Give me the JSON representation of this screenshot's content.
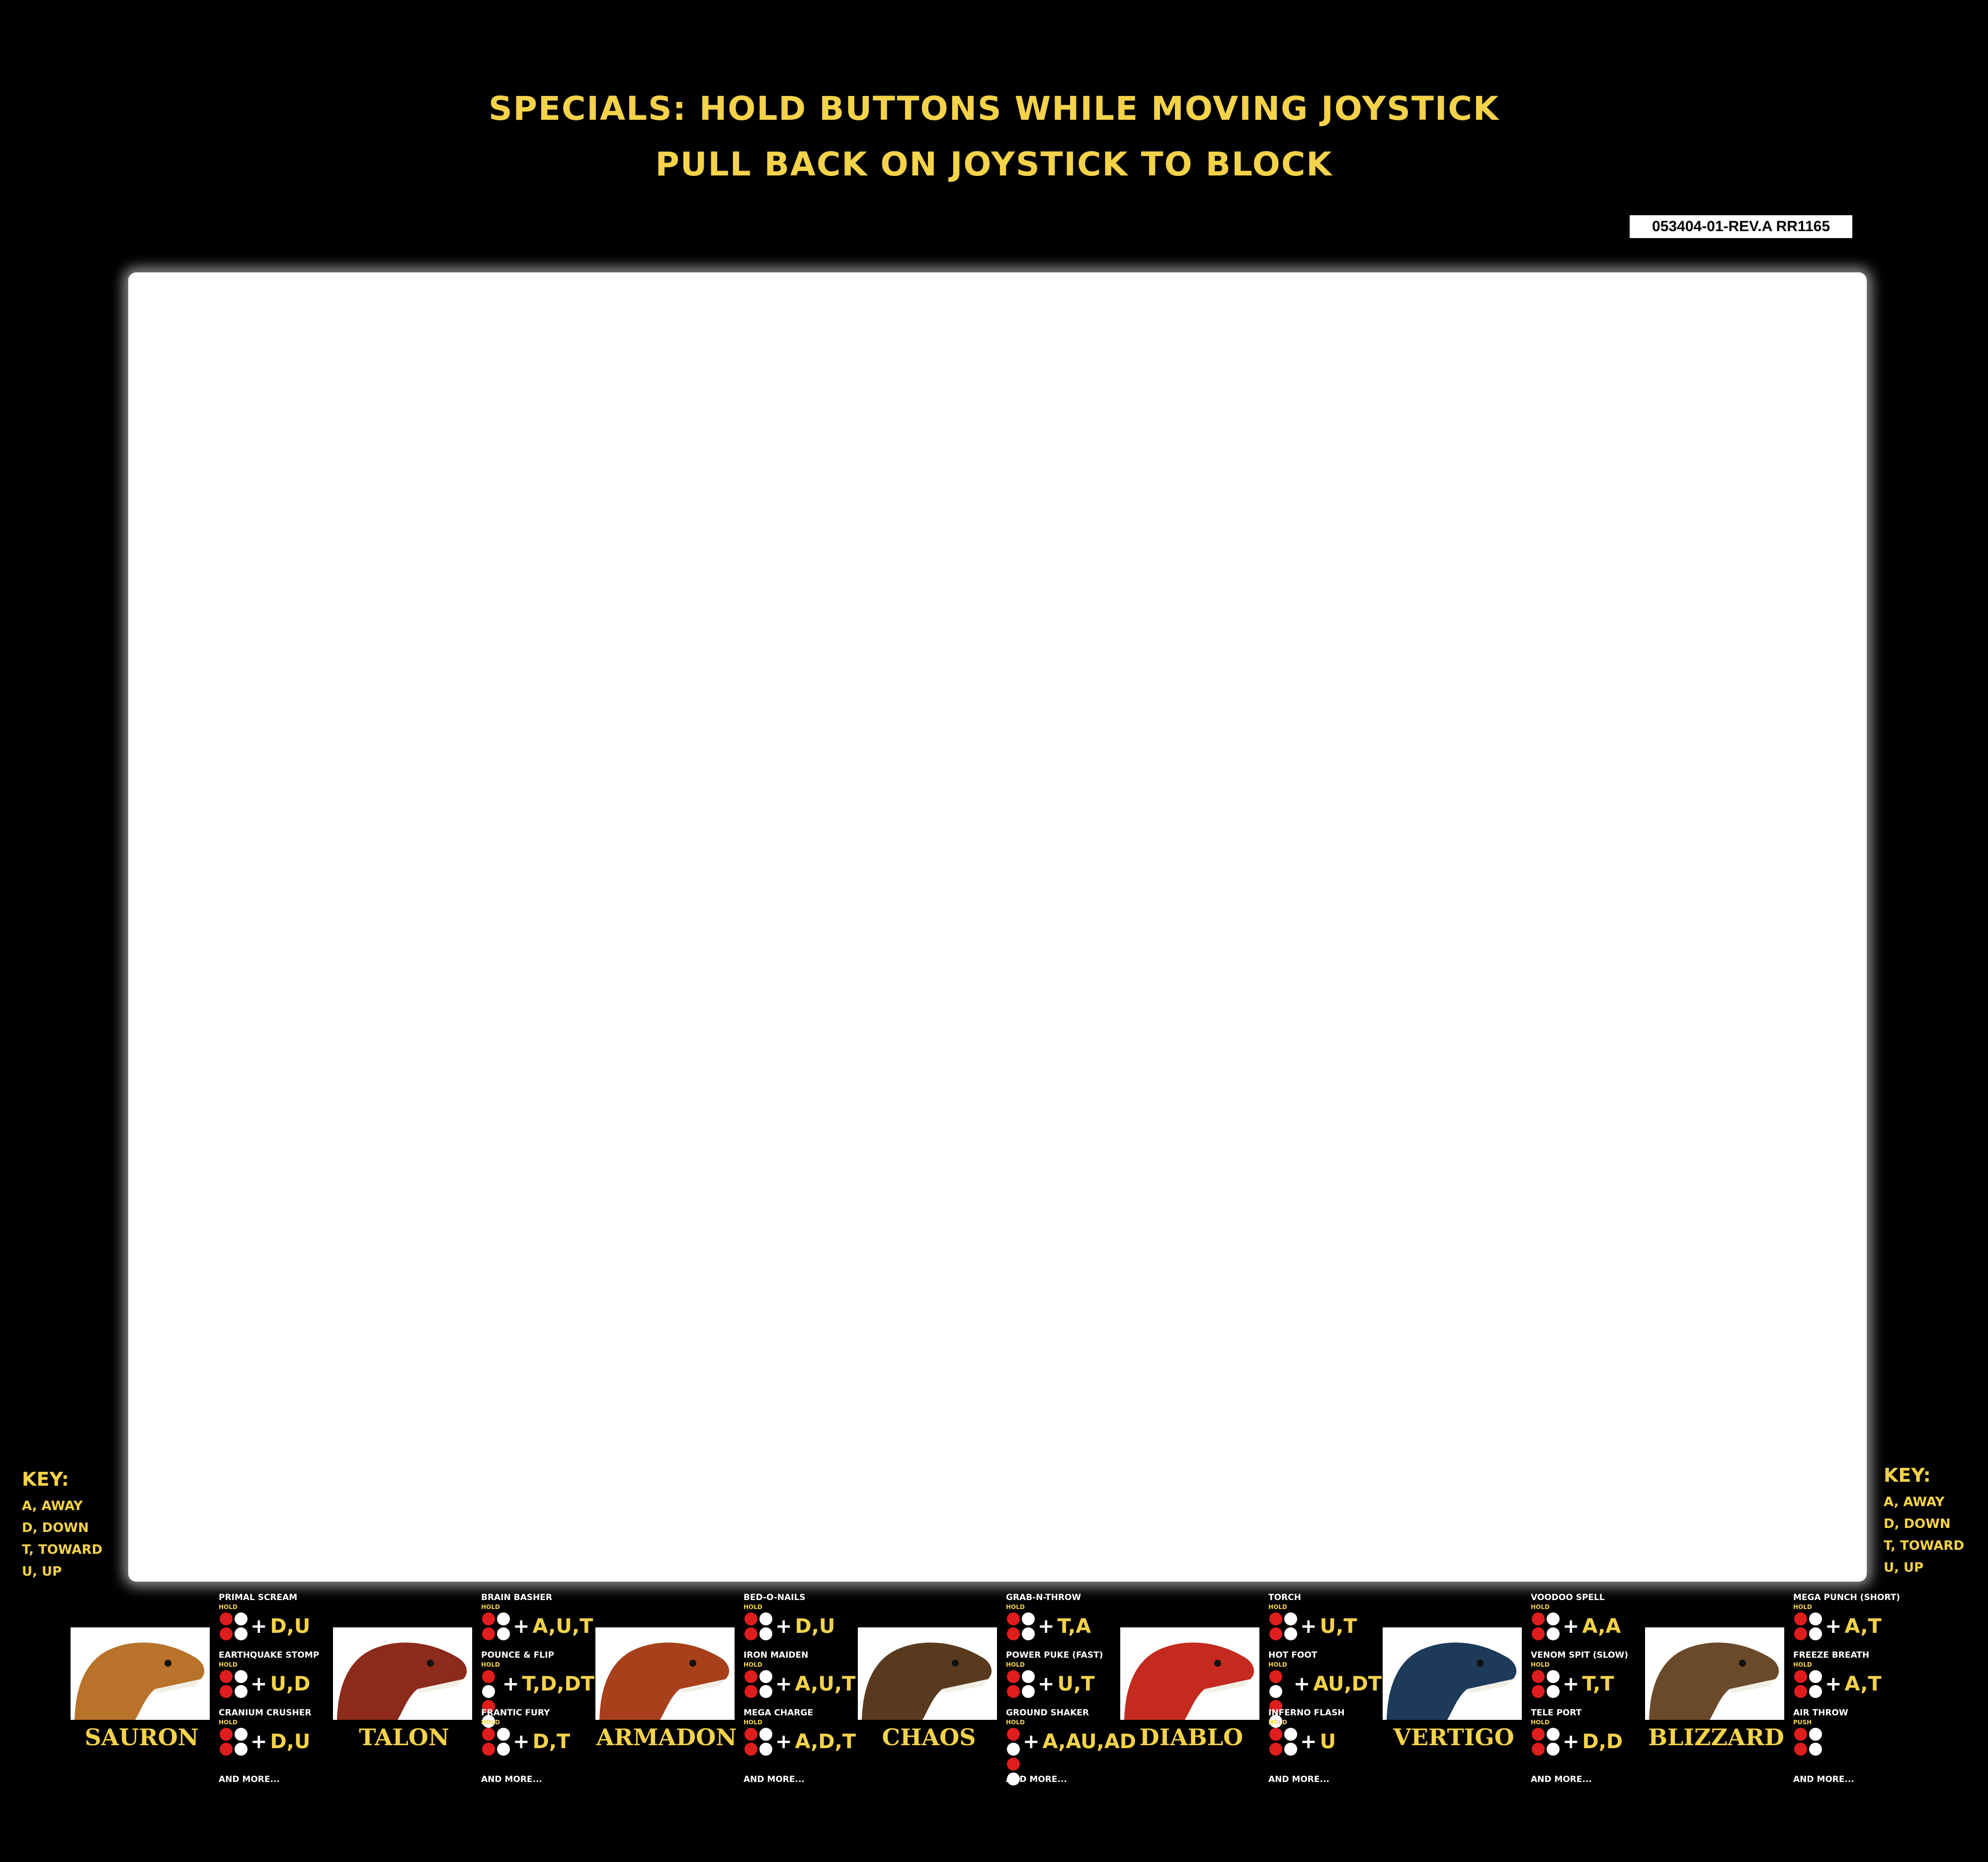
{
  "header": {
    "line1": "SPECIALS: HOLD BUTTONS WHILE MOVING JOYSTICK",
    "line2": "PULL BACK ON JOYSTICK TO BLOCK",
    "part_number": "053404-01-REV.A RR1165"
  },
  "key": {
    "title": "KEY:",
    "lines": [
      "A, AWAY",
      "D, DOWN",
      "T, TOWARD",
      "U, UP"
    ]
  },
  "colors": {
    "accent": "#f4d24a",
    "button_red": "#e01d1d",
    "background": "#000000"
  },
  "fighters": [
    {
      "name": "SAURON",
      "portrait_color": "#b8722a",
      "moves": [
        {
          "name": "PRIMAL SCREAM",
          "label": "HOLD",
          "combo": "D,U"
        },
        {
          "name": "EARTHQUAKE STOMP",
          "label": "HOLD",
          "combo": "U,D"
        },
        {
          "name": "CRANIUM CRUSHER",
          "label": "HOLD",
          "combo": "D,U"
        }
      ],
      "more": "AND MORE..."
    },
    {
      "name": "TALON",
      "portrait_color": "#8c2a1c",
      "moves": [
        {
          "name": "BRAIN BASHER",
          "label": "HOLD",
          "combo": "A,U,T"
        },
        {
          "name": "POUNCE & FLIP",
          "label": "HOLD",
          "combo": "T,D,DT"
        },
        {
          "name": "FRANTIC FURY",
          "label": "HOLD",
          "combo": "D,T"
        }
      ],
      "more": "AND MORE..."
    },
    {
      "name": "ARMADON",
      "portrait_color": "#a8401c",
      "moves": [
        {
          "name": "BED-O-NAILS",
          "label": "HOLD",
          "combo": "D,U"
        },
        {
          "name": "IRON MAIDEN",
          "label": "HOLD",
          "combo": "A,U,T"
        },
        {
          "name": "MEGA CHARGE",
          "label": "HOLD",
          "combo": "A,D,T"
        }
      ],
      "more": "AND MORE..."
    },
    {
      "name": "CHAOS",
      "portrait_color": "#5a3a1e",
      "moves": [
        {
          "name": "GRAB-N-THROW",
          "label": "HOLD",
          "combo": "T,A"
        },
        {
          "name": "POWER PUKE (FAST)",
          "label": "HOLD",
          "combo": "U,T"
        },
        {
          "name": "GROUND SHAKER",
          "label": "HOLD",
          "combo": "A,AU,AD"
        }
      ],
      "more": "AND MORE..."
    },
    {
      "name": "DIABLO",
      "portrait_color": "#c42a1e",
      "moves": [
        {
          "name": "TORCH",
          "label": "HOLD",
          "combo": "U,T"
        },
        {
          "name": "HOT FOOT",
          "label": "HOLD",
          "combo": "AU,DT"
        },
        {
          "name": "INFERNO FLASH",
          "label": "HOLD",
          "combo": "U"
        }
      ],
      "more": "AND MORE..."
    },
    {
      "name": "VERTIGO",
      "portrait_color": "#1e3a5a",
      "moves": [
        {
          "name": "VOODOO SPELL",
          "label": "HOLD",
          "combo": "A,A"
        },
        {
          "name": "VENOM SPIT (SLOW)",
          "label": "HOLD",
          "combo": "T,T"
        },
        {
          "name": "TELE PORT",
          "label": "HOLD",
          "combo": "D,D"
        }
      ],
      "more": "AND MORE..."
    },
    {
      "name": "BLIZZARD",
      "portrait_color": "#6a4a2a",
      "moves": [
        {
          "name": "MEGA PUNCH (SHORT)",
          "label": "HOLD",
          "combo": "A,T"
        },
        {
          "name": "FREEZE BREATH",
          "label": "HOLD",
          "combo": "A,T"
        },
        {
          "name": "AIR THROW",
          "label": "PUSH",
          "combo": ""
        }
      ],
      "more": "AND MORE..."
    }
  ]
}
